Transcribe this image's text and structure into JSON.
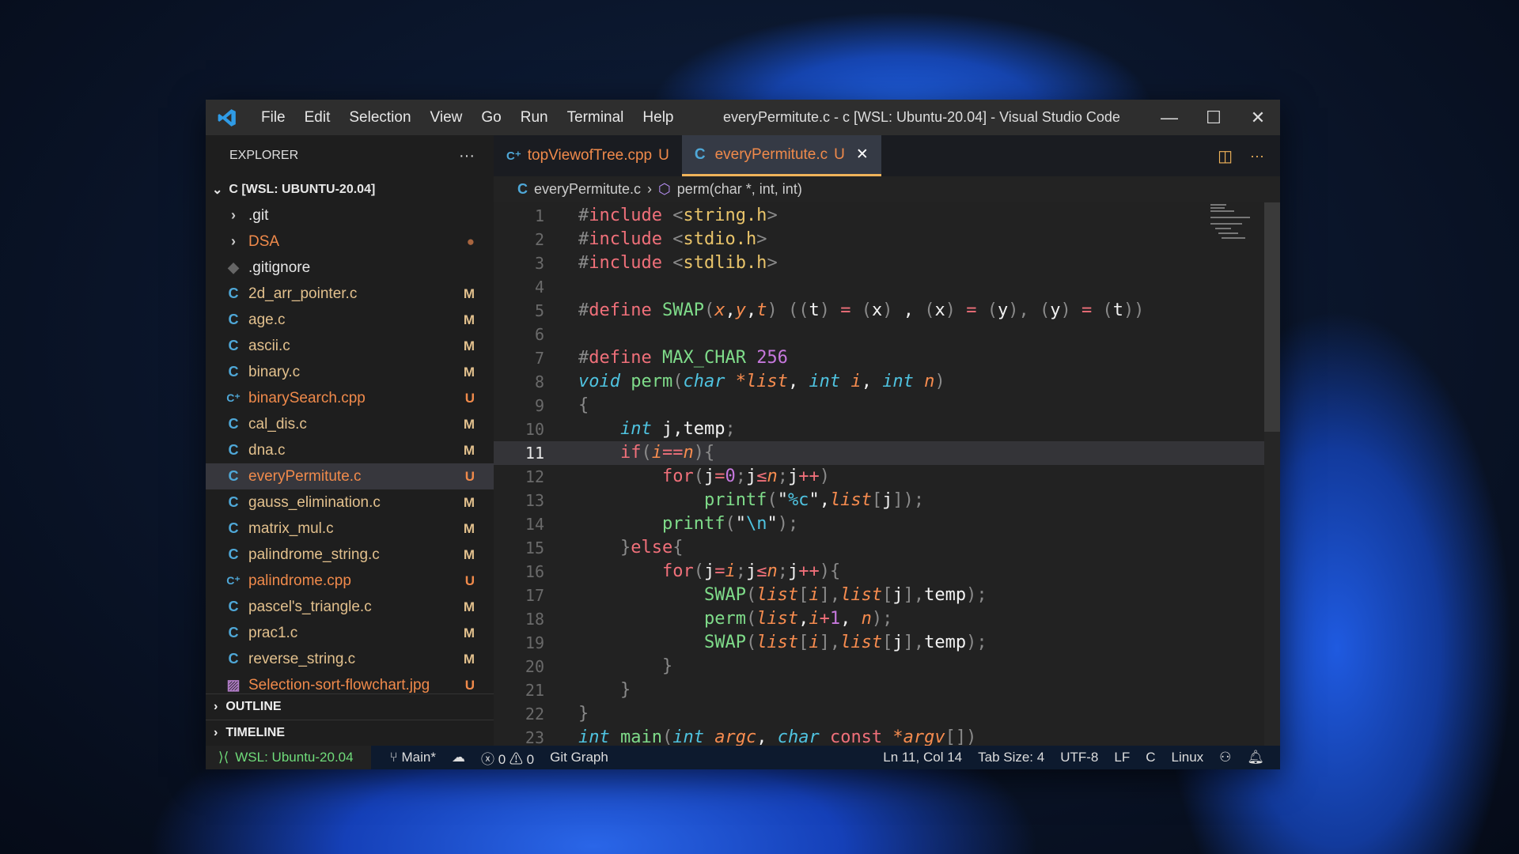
{
  "window": {
    "title": "everyPermitute.c - c [WSL: Ubuntu-20.04] - Visual Studio Code",
    "menu": [
      "File",
      "Edit",
      "Selection",
      "View",
      "Go",
      "Run",
      "Terminal",
      "Help"
    ]
  },
  "sidebar": {
    "header": "EXPLORER",
    "root": "C [WSL: UBUNTU-20.04]",
    "outline": "OUTLINE",
    "timeline": "TIMELINE",
    "items": [
      {
        "name": ".git",
        "type": "folder",
        "status": "",
        "color": "#e8e8e8"
      },
      {
        "name": "DSA",
        "type": "folder",
        "status": "●",
        "color": "#f08a4b"
      },
      {
        "name": ".gitignore",
        "type": "git",
        "status": "",
        "color": "#e8e8e8"
      },
      {
        "name": "2d_arr_pointer.c",
        "type": "c",
        "status": "M",
        "color": "#e2c08d"
      },
      {
        "name": "age.c",
        "type": "c",
        "status": "M",
        "color": "#e2c08d"
      },
      {
        "name": "ascii.c",
        "type": "c",
        "status": "M",
        "color": "#e2c08d"
      },
      {
        "name": "binary.c",
        "type": "c",
        "status": "M",
        "color": "#e2c08d"
      },
      {
        "name": "binarySearch.cpp",
        "type": "cpp",
        "status": "U",
        "color": "#f08a4b"
      },
      {
        "name": "cal_dis.c",
        "type": "c",
        "status": "M",
        "color": "#e2c08d"
      },
      {
        "name": "dna.c",
        "type": "c",
        "status": "M",
        "color": "#e2c08d"
      },
      {
        "name": "everyPermitute.c",
        "type": "c",
        "status": "U",
        "color": "#f08a4b",
        "selected": true
      },
      {
        "name": "gauss_elimination.c",
        "type": "c",
        "status": "M",
        "color": "#e2c08d"
      },
      {
        "name": "matrix_mul.c",
        "type": "c",
        "status": "M",
        "color": "#e2c08d"
      },
      {
        "name": "palindrome_string.c",
        "type": "c",
        "status": "M",
        "color": "#e2c08d"
      },
      {
        "name": "palindrome.cpp",
        "type": "cpp",
        "status": "U",
        "color": "#f08a4b"
      },
      {
        "name": "pascel's_triangle.c",
        "type": "c",
        "status": "M",
        "color": "#e2c08d"
      },
      {
        "name": "prac1.c",
        "type": "c",
        "status": "M",
        "color": "#e2c08d"
      },
      {
        "name": "reverse_string.c",
        "type": "c",
        "status": "M",
        "color": "#e2c08d"
      },
      {
        "name": "Selection-sort-flowchart.jpg",
        "type": "image",
        "status": "U",
        "color": "#f08a4b"
      }
    ]
  },
  "tabs": [
    {
      "label": "topViewofTree.cpp",
      "status": "U",
      "icon": "C++",
      "active": false
    },
    {
      "label": "everyPermitute.c",
      "status": "U",
      "icon": "C",
      "active": true
    }
  ],
  "breadcrumb": {
    "file": "everyPermitute.c",
    "symbol": "perm(char *, int, int)"
  },
  "editor": {
    "current_line": 11,
    "lines": [
      {
        "n": 1,
        "t": [
          [
            "#",
            "p"
          ],
          [
            "include",
            "k"
          ],
          [
            " <",
            "p"
          ],
          [
            "string.h",
            "s"
          ],
          [
            ">",
            "p"
          ]
        ]
      },
      {
        "n": 2,
        "t": [
          [
            "#",
            "p"
          ],
          [
            "include",
            "k"
          ],
          [
            " <",
            "p"
          ],
          [
            "stdio.h",
            "s"
          ],
          [
            ">",
            "p"
          ]
        ]
      },
      {
        "n": 3,
        "t": [
          [
            "#",
            "p"
          ],
          [
            "include",
            "k"
          ],
          [
            " <",
            "p"
          ],
          [
            "stdlib.h",
            "s"
          ],
          [
            ">",
            "p"
          ]
        ]
      },
      {
        "n": 4,
        "t": []
      },
      {
        "n": 5,
        "t": [
          [
            "#",
            "p"
          ],
          [
            "define",
            "k"
          ],
          [
            " SWAP",
            "f"
          ],
          [
            "(",
            "p"
          ],
          [
            "x",
            "pa"
          ],
          [
            ",",
            "v"
          ],
          [
            "y",
            "pa"
          ],
          [
            ",",
            "v"
          ],
          [
            "t",
            "pa"
          ],
          [
            ") ((",
            "p"
          ],
          [
            "t",
            "v"
          ],
          [
            ") ",
            "p"
          ],
          [
            "=",
            "op"
          ],
          [
            " (",
            "p"
          ],
          [
            "x",
            "v"
          ],
          [
            ") ",
            "p"
          ],
          [
            ",",
            "v"
          ],
          [
            " (",
            "p"
          ],
          [
            "x",
            "v"
          ],
          [
            ") ",
            "p"
          ],
          [
            "=",
            "op"
          ],
          [
            " (",
            "p"
          ],
          [
            "y",
            "v"
          ],
          [
            "), (",
            "p"
          ],
          [
            "y",
            "v"
          ],
          [
            ") ",
            "p"
          ],
          [
            "=",
            "op"
          ],
          [
            " (",
            "p"
          ],
          [
            "t",
            "v"
          ],
          [
            "))",
            "p"
          ]
        ]
      },
      {
        "n": 6,
        "t": []
      },
      {
        "n": 7,
        "t": [
          [
            "#",
            "p"
          ],
          [
            "define",
            "k"
          ],
          [
            " MAX_CHAR ",
            "f"
          ],
          [
            "256",
            "nu"
          ]
        ]
      },
      {
        "n": 8,
        "t": [
          [
            "void",
            "ty"
          ],
          [
            " perm",
            "f"
          ],
          [
            "(",
            "p"
          ],
          [
            "char",
            "ty"
          ],
          [
            " *list",
            "pa"
          ],
          [
            ", ",
            "v"
          ],
          [
            "int",
            "ty"
          ],
          [
            " i",
            "pa"
          ],
          [
            ", ",
            "v"
          ],
          [
            "int",
            "ty"
          ],
          [
            " n",
            "pa"
          ],
          [
            ")",
            "p"
          ]
        ]
      },
      {
        "n": 9,
        "t": [
          [
            "{",
            "p"
          ]
        ]
      },
      {
        "n": 10,
        "t": [
          [
            "    ",
            "v"
          ],
          [
            "int",
            "ty"
          ],
          [
            " j,temp",
            "v"
          ],
          [
            ";",
            "p"
          ]
        ]
      },
      {
        "n": 11,
        "t": [
          [
            "    ",
            "v"
          ],
          [
            "if",
            "k"
          ],
          [
            "(",
            "p"
          ],
          [
            "i",
            "pa"
          ],
          [
            "==",
            "op"
          ],
          [
            "n",
            "pa"
          ],
          [
            ")",
            "p"
          ],
          [
            "{",
            "p"
          ]
        ]
      },
      {
        "n": 12,
        "t": [
          [
            "        ",
            "v"
          ],
          [
            "for",
            "k"
          ],
          [
            "(",
            "p"
          ],
          [
            "j",
            "v"
          ],
          [
            "=",
            "op"
          ],
          [
            "0",
            "nu"
          ],
          [
            ";",
            "p"
          ],
          [
            "j",
            "v"
          ],
          [
            "≤",
            "op"
          ],
          [
            "n",
            "pa"
          ],
          [
            ";",
            "p"
          ],
          [
            "j",
            "v"
          ],
          [
            "++",
            "op"
          ],
          [
            ")",
            "p"
          ]
        ]
      },
      {
        "n": 13,
        "t": [
          [
            "            ",
            "v"
          ],
          [
            "printf",
            "f"
          ],
          [
            "(",
            "p"
          ],
          [
            "\"",
            "v"
          ],
          [
            "%c",
            "e"
          ],
          [
            "\"",
            "v"
          ],
          [
            ",",
            "v"
          ],
          [
            "list",
            "pa"
          ],
          [
            "[",
            "p"
          ],
          [
            "j",
            "v"
          ],
          [
            "])",
            "p"
          ],
          [
            ";",
            "p"
          ]
        ]
      },
      {
        "n": 14,
        "t": [
          [
            "        ",
            "v"
          ],
          [
            "printf",
            "f"
          ],
          [
            "(",
            "p"
          ],
          [
            "\"",
            "v"
          ],
          [
            "\\n",
            "e"
          ],
          [
            "\"",
            "v"
          ],
          [
            ")",
            "p"
          ],
          [
            ";",
            "p"
          ]
        ]
      },
      {
        "n": 15,
        "t": [
          [
            "    ",
            "v"
          ],
          [
            "}",
            "p"
          ],
          [
            "else",
            "k"
          ],
          [
            "{",
            "p"
          ]
        ]
      },
      {
        "n": 16,
        "t": [
          [
            "        ",
            "v"
          ],
          [
            "for",
            "k"
          ],
          [
            "(",
            "p"
          ],
          [
            "j",
            "v"
          ],
          [
            "=",
            "op"
          ],
          [
            "i",
            "pa"
          ],
          [
            ";",
            "p"
          ],
          [
            "j",
            "v"
          ],
          [
            "≤",
            "op"
          ],
          [
            "n",
            "pa"
          ],
          [
            ";",
            "p"
          ],
          [
            "j",
            "v"
          ],
          [
            "++",
            "op"
          ],
          [
            "){",
            "p"
          ]
        ]
      },
      {
        "n": 17,
        "t": [
          [
            "            ",
            "v"
          ],
          [
            "SWAP",
            "f"
          ],
          [
            "(",
            "p"
          ],
          [
            "list",
            "pa"
          ],
          [
            "[",
            "p"
          ],
          [
            "i",
            "pa"
          ],
          [
            "],",
            "p"
          ],
          [
            "list",
            "pa"
          ],
          [
            "[",
            "p"
          ],
          [
            "j",
            "v"
          ],
          [
            "],",
            "p"
          ],
          [
            "temp",
            "v"
          ],
          [
            ")",
            "p"
          ],
          [
            ";",
            "p"
          ]
        ]
      },
      {
        "n": 18,
        "t": [
          [
            "            ",
            "v"
          ],
          [
            "perm",
            "f"
          ],
          [
            "(",
            "p"
          ],
          [
            "list",
            "pa"
          ],
          [
            ",",
            "v"
          ],
          [
            "i",
            "pa"
          ],
          [
            "+",
            "op"
          ],
          [
            "1",
            "nu"
          ],
          [
            ", ",
            "v"
          ],
          [
            "n",
            "pa"
          ],
          [
            ")",
            "p"
          ],
          [
            ";",
            "p"
          ]
        ]
      },
      {
        "n": 19,
        "t": [
          [
            "            ",
            "v"
          ],
          [
            "SWAP",
            "f"
          ],
          [
            "(",
            "p"
          ],
          [
            "list",
            "pa"
          ],
          [
            "[",
            "p"
          ],
          [
            "i",
            "pa"
          ],
          [
            "],",
            "p"
          ],
          [
            "list",
            "pa"
          ],
          [
            "[",
            "p"
          ],
          [
            "j",
            "v"
          ],
          [
            "],",
            "p"
          ],
          [
            "temp",
            "v"
          ],
          [
            ")",
            "p"
          ],
          [
            ";",
            "p"
          ]
        ]
      },
      {
        "n": 20,
        "t": [
          [
            "        ",
            "v"
          ],
          [
            "}",
            "p"
          ]
        ]
      },
      {
        "n": 21,
        "t": [
          [
            "    ",
            "v"
          ],
          [
            "}",
            "p"
          ]
        ]
      },
      {
        "n": 22,
        "t": [
          [
            "}",
            "p"
          ]
        ]
      },
      {
        "n": 23,
        "t": [
          [
            "int",
            "ty"
          ],
          [
            " main",
            "f"
          ],
          [
            "(",
            "p"
          ],
          [
            "int",
            "ty"
          ],
          [
            " argc",
            "pa"
          ],
          [
            ", ",
            "v"
          ],
          [
            "char",
            "ty"
          ],
          [
            " const ",
            "k"
          ],
          [
            "*argv",
            "pa"
          ],
          [
            "[])",
            "p"
          ]
        ]
      }
    ]
  },
  "status": {
    "remote": "WSL: Ubuntu-20.04",
    "branch": "Main*",
    "errors": "0",
    "warnings": "0",
    "git_graph": "Git Graph",
    "position": "Ln 11, Col 14",
    "tab_size": "Tab Size: 4",
    "encoding": "UTF-8",
    "eol": "LF",
    "language": "C",
    "os": "Linux"
  },
  "colors": {
    "accent_tab": "#f0b35a",
    "c_icon": "#4fa8d8",
    "remote": "#6fdc7a"
  }
}
